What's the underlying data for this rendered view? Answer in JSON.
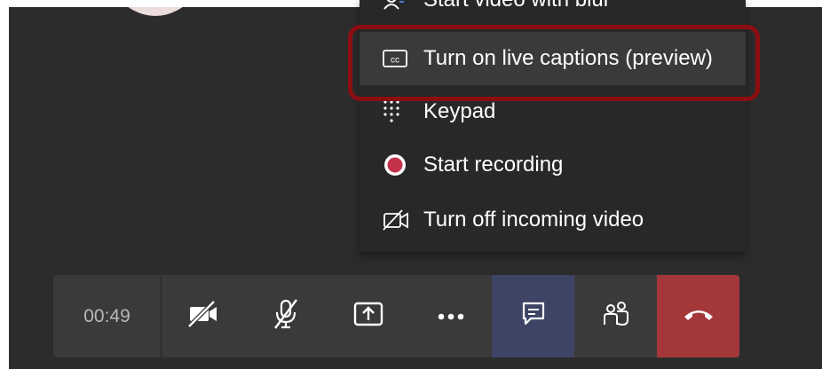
{
  "menu": {
    "items": [
      {
        "label": "Start video with blur",
        "icon": "blur-background-icon"
      },
      {
        "label": "Turn on live captions (preview)",
        "icon": "cc-captions-icon"
      },
      {
        "label": "Keypad",
        "icon": "dialpad-icon"
      },
      {
        "label": "Start recording",
        "icon": "record-icon"
      },
      {
        "label": "Turn off incoming video",
        "icon": "video-off-icon"
      }
    ]
  },
  "callbar": {
    "timer": "00:49",
    "buttons": [
      {
        "name": "camera-toggle",
        "icon": "video-off-icon"
      },
      {
        "name": "mic-toggle",
        "icon": "mic-off-icon"
      },
      {
        "name": "share-screen",
        "icon": "share-tray-icon"
      },
      {
        "name": "more-actions",
        "icon": "more-dots-icon"
      },
      {
        "name": "chat",
        "icon": "chat-icon"
      },
      {
        "name": "participants",
        "icon": "people-icon"
      },
      {
        "name": "hang-up",
        "icon": "phone-hangup-icon"
      }
    ]
  },
  "colors": {
    "stage": "#2d2c2c",
    "menu": "#292828",
    "menu_hover": "#3b3a39",
    "highlight_border": "#8b0e12",
    "record": "#c4314b",
    "hangup": "#a4373a",
    "chat_active": "#3e4466"
  }
}
